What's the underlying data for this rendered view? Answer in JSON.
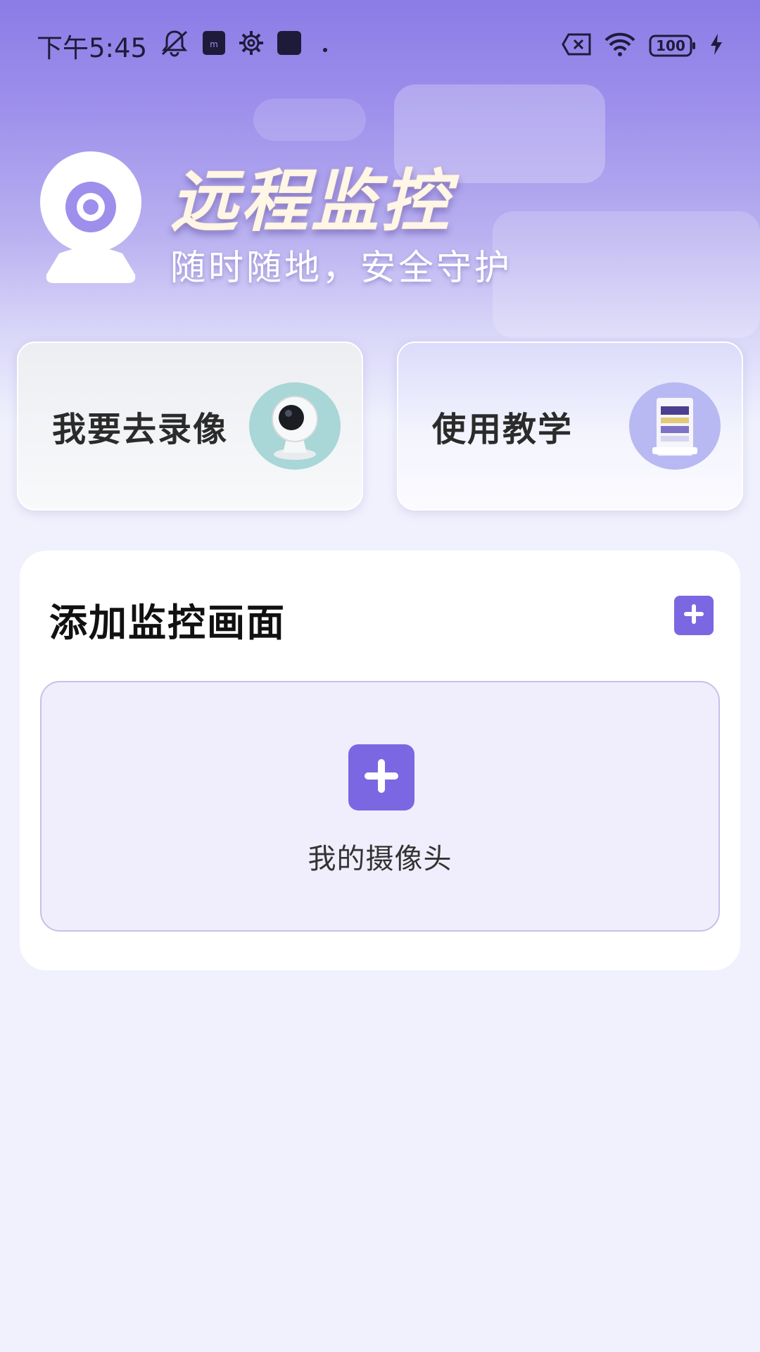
{
  "status_bar": {
    "time": "下午5:45",
    "battery": "100",
    "icons": [
      "notifications-off-icon",
      "sim-icon",
      "settings-gear-icon",
      "app-icon",
      "dot-icon",
      "no-sim-icon",
      "wifi-icon",
      "battery-icon",
      "charging-bolt-icon"
    ]
  },
  "hero": {
    "title": "远程监控",
    "subtitle": "随时随地，安全守护",
    "logo_icon": "webcam-icon"
  },
  "actions": [
    {
      "label": "我要去录像",
      "icon": "camera-thumbnail-icon"
    },
    {
      "label": "使用教学",
      "icon": "tutorial-book-icon"
    }
  ],
  "panel": {
    "title": "添加监控画面",
    "add_icon": "plus-icon",
    "slot_label": "我的摄像头"
  },
  "colors": {
    "accent": "#7b67e2",
    "background": "#f0f1fd",
    "hero_top": "#8b7be6"
  }
}
